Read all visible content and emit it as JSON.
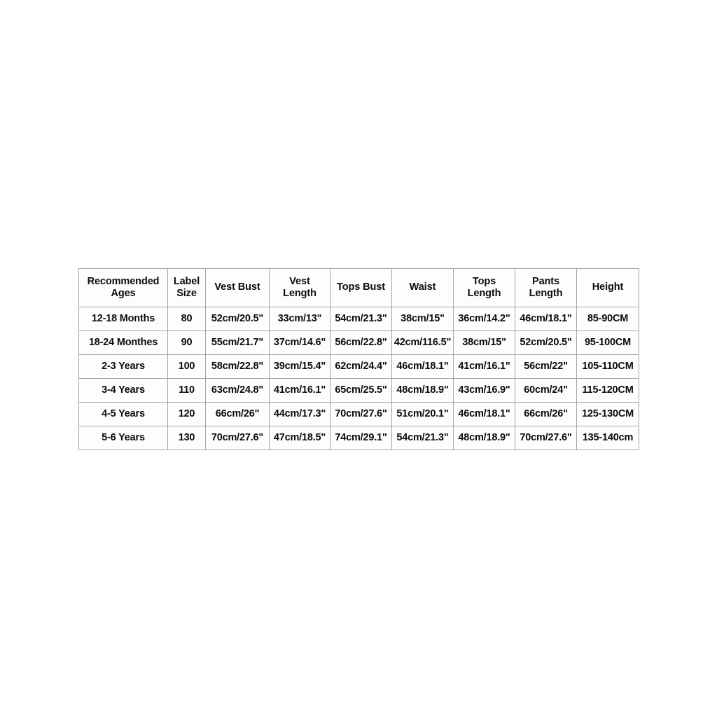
{
  "table": {
    "name": "size-chart",
    "colors": {
      "page_background": "#ffffff",
      "cell_background": "#fdfdfb",
      "border": "#a6a6a6",
      "text": "#0b0b0b"
    },
    "headers": [
      {
        "id": "recommended-ages",
        "line1": "Recommended",
        "line2": "Ages"
      },
      {
        "id": "label-size",
        "line1": "Label",
        "line2": "Size"
      },
      {
        "id": "vest-bust",
        "line1": "Vest Bust",
        "line2": ""
      },
      {
        "id": "vest-length",
        "line1": "Vest",
        "line2": "Length"
      },
      {
        "id": "tops-bust",
        "line1": "Tops Bust",
        "line2": ""
      },
      {
        "id": "waist",
        "line1": "Waist",
        "line2": ""
      },
      {
        "id": "tops-length",
        "line1": "Tops",
        "line2": "Length"
      },
      {
        "id": "pants-length",
        "line1": "Pants",
        "line2": "Length"
      },
      {
        "id": "height",
        "line1": "Height",
        "line2": ""
      }
    ],
    "rows": [
      {
        "recommended_ages": "12-18 Months",
        "label_size": "80",
        "vest_bust": "52cm/20.5\"",
        "vest_length": "33cm/13\"",
        "tops_bust": "54cm/21.3\"",
        "waist": "38cm/15\"",
        "tops_length": "36cm/14.2\"",
        "pants_length": "46cm/18.1\"",
        "height": "85-90CM"
      },
      {
        "recommended_ages": "18-24 Monthes",
        "label_size": "90",
        "vest_bust": "55cm/21.7\"",
        "vest_length": "37cm/14.6\"",
        "tops_bust": "56cm/22.8\"",
        "waist": "42cm/116.5\"",
        "tops_length": "38cm/15\"",
        "pants_length": "52cm/20.5\"",
        "height": "95-100CM"
      },
      {
        "recommended_ages": "2-3 Years",
        "label_size": "100",
        "vest_bust": "58cm/22.8\"",
        "vest_length": "39cm/15.4\"",
        "tops_bust": "62cm/24.4\"",
        "waist": "46cm/18.1\"",
        "tops_length": "41cm/16.1\"",
        "pants_length": "56cm/22\"",
        "height": "105-110CM"
      },
      {
        "recommended_ages": "3-4 Years",
        "label_size": "110",
        "vest_bust": "63cm/24.8\"",
        "vest_length": "41cm/16.1\"",
        "tops_bust": "65cm/25.5\"",
        "waist": "48cm/18.9\"",
        "tops_length": "43cm/16.9\"",
        "pants_length": "60cm/24\"",
        "height": "115-120CM"
      },
      {
        "recommended_ages": "4-5 Years",
        "label_size": "120",
        "vest_bust": "66cm/26\"",
        "vest_length": "44cm/17.3\"",
        "tops_bust": "70cm/27.6\"",
        "waist": "51cm/20.1\"",
        "tops_length": "46cm/18.1\"",
        "pants_length": "66cm/26\"",
        "height": "125-130CM"
      },
      {
        "recommended_ages": "5-6 Years",
        "label_size": "130",
        "vest_bust": "70cm/27.6\"",
        "vest_length": "47cm/18.5\"",
        "tops_bust": "74cm/29.1\"",
        "waist": "54cm/21.3\"",
        "tops_length": "48cm/18.9\"",
        "pants_length": "70cm/27.6\"",
        "height": "135-140cm"
      }
    ]
  }
}
